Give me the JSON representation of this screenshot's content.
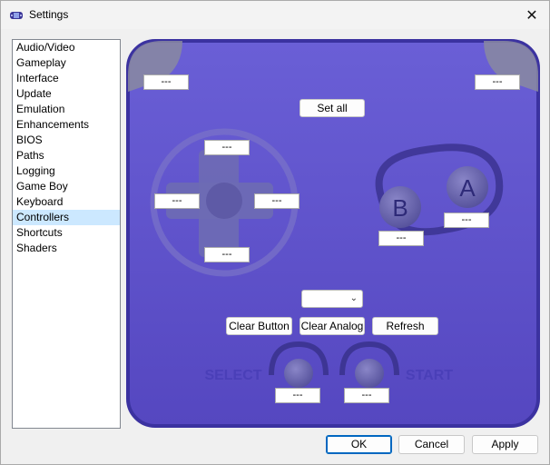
{
  "window": {
    "title": "Settings",
    "close_symbol": "✕"
  },
  "sidebar": {
    "items": [
      {
        "label": "Audio/Video"
      },
      {
        "label": "Gameplay"
      },
      {
        "label": "Interface"
      },
      {
        "label": "Update"
      },
      {
        "label": "Emulation"
      },
      {
        "label": "Enhancements"
      },
      {
        "label": "BIOS"
      },
      {
        "label": "Paths"
      },
      {
        "label": "Logging"
      },
      {
        "label": "Game Boy"
      },
      {
        "label": "Keyboard"
      },
      {
        "label": "Controllers",
        "selected": true
      },
      {
        "label": "Shortcuts"
      },
      {
        "label": "Shaders"
      }
    ]
  },
  "controller": {
    "set_all_label": "Set all",
    "bindings": {
      "l": "---",
      "r": "---",
      "up": "---",
      "left": "---",
      "right": "---",
      "down": "---",
      "b": "---",
      "a": "---",
      "select": "---",
      "start": "---"
    },
    "pad_labels": {
      "a": "A",
      "b": "B",
      "select": "SELECT",
      "start": "START"
    },
    "device_select_value": "",
    "clear_button_label": "Clear Button",
    "clear_analog_label": "Clear Analog",
    "refresh_label": "Refresh"
  },
  "footer": {
    "ok_label": "OK",
    "cancel_label": "Cancel",
    "apply_label": "Apply"
  },
  "colors": {
    "pad_body": "#5a4ec4",
    "pad_border": "#3b32a0",
    "pad_dark": "#4a41b0",
    "selection": "#cce8ff",
    "accent": "#0067c0"
  }
}
